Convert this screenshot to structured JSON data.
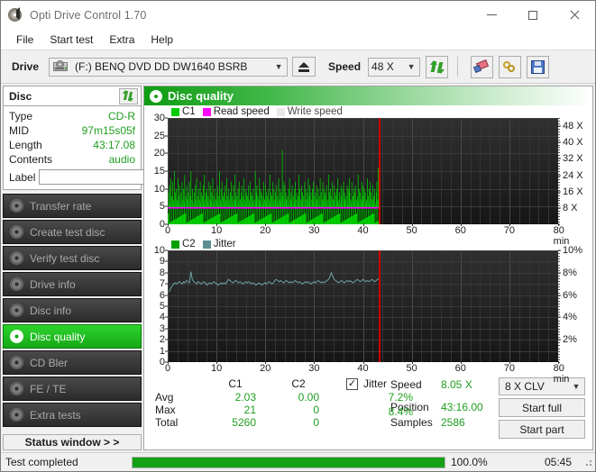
{
  "window": {
    "title": "Opti Drive Control 1.70",
    "icon": "disc-icon",
    "controls": {
      "minimize": "minimize",
      "maximize": "maximize",
      "close": "close"
    }
  },
  "menu": {
    "items": [
      "File",
      "Start test",
      "Extra",
      "Help"
    ]
  },
  "toolbar": {
    "drive_label": "Drive",
    "drive_value": "(F:)   BENQ DVD DD DW1640 BSRB",
    "eject_icon": "eject-icon",
    "speed_label": "Speed",
    "speed_value": "48 X",
    "refresh_icon": "refresh-icon",
    "erase_icon": "eraser-icon",
    "key_icon": "key-icon",
    "save_icon": "save-icon"
  },
  "disc_panel": {
    "title": "Disc",
    "refresh_icon": "refresh-icon",
    "rows": [
      {
        "key": "Type",
        "value": "CD-R"
      },
      {
        "key": "MID",
        "value": "97m15s05f"
      },
      {
        "key": "Length",
        "value": "43:17.08"
      },
      {
        "key": "Contents",
        "value": "audio"
      }
    ],
    "label_key": "Label",
    "label_value": "",
    "label_placeholder": "",
    "cd_icon": "cd-icon"
  },
  "sidebar": {
    "items": [
      {
        "label": "Transfer rate",
        "icon": "disc-icon",
        "active": false
      },
      {
        "label": "Create test disc",
        "icon": "disc-write-icon",
        "active": false
      },
      {
        "label": "Verify test disc",
        "icon": "disc-check-icon",
        "active": false
      },
      {
        "label": "Drive info",
        "icon": "drive-info-icon",
        "active": false
      },
      {
        "label": "Disc info",
        "icon": "disc-info-icon",
        "active": false
      },
      {
        "label": "Disc quality",
        "icon": "disc-quality-icon",
        "active": true
      },
      {
        "label": "CD Bler",
        "icon": "disc-icon",
        "active": false
      },
      {
        "label": "FE / TE",
        "icon": "disc-icon",
        "active": false
      },
      {
        "label": "Extra tests",
        "icon": "disc-icon",
        "active": false
      }
    ],
    "status_window": "Status window > >"
  },
  "main": {
    "header_title": "Disc quality",
    "header_icon": "disc-quality-icon"
  },
  "chart_data": [
    {
      "type": "line",
      "name": "c1-chart",
      "title": "",
      "xlabel": "min",
      "ylabel": "",
      "xlim": [
        0,
        80
      ],
      "ylim": [
        0,
        30
      ],
      "xticks": [
        0,
        10,
        20,
        30,
        40,
        50,
        60,
        70,
        80
      ],
      "yticks": [
        0,
        5,
        10,
        15,
        20,
        25,
        30
      ],
      "x_unit": "min",
      "y2lim": [
        0,
        52
      ],
      "y2ticks": [
        8,
        16,
        24,
        32,
        40,
        48
      ],
      "y2ticklabels": [
        "8 X",
        "16 X",
        "24 X",
        "32 X",
        "40 X",
        "48 X"
      ],
      "grid": true,
      "legend": [
        {
          "label": "C1",
          "color": "#00cc00"
        },
        {
          "label": "Read speed",
          "color": "#ff00ff"
        },
        {
          "label": "Write speed",
          "color": "#e8e8e8"
        }
      ],
      "cursor_position_min": 43.3,
      "data_end_min": 43.3,
      "series": [
        {
          "name": "C1",
          "color": "#00cc00",
          "type": "impulse",
          "x_start": 0,
          "x_end": 43.3,
          "values": [
            5,
            9,
            4,
            11,
            6,
            13,
            5,
            8,
            4,
            12,
            7,
            6,
            15,
            5,
            9,
            4,
            10,
            6,
            7,
            13,
            5,
            8,
            11,
            4,
            6,
            9,
            5,
            12,
            7,
            4,
            10,
            6,
            14,
            5,
            8,
            4,
            11,
            7,
            5,
            9,
            6,
            12,
            4,
            8,
            15,
            5,
            7,
            10,
            4,
            6,
            9,
            5,
            11,
            7,
            4,
            13,
            6,
            8,
            5,
            10,
            4,
            7,
            12,
            6,
            9,
            5,
            8,
            4,
            11,
            6,
            14,
            5,
            7,
            9,
            4,
            10,
            6,
            8,
            5,
            12,
            4,
            7,
            11,
            6,
            9,
            5,
            13,
            4,
            8,
            6,
            10,
            5,
            7,
            4,
            9,
            11,
            6,
            8,
            5,
            15,
            4,
            7,
            10,
            6,
            12,
            5,
            8,
            4,
            9,
            6,
            11,
            7,
            5,
            13,
            4,
            8,
            6,
            10,
            5,
            7,
            9,
            4,
            12,
            6,
            8,
            5,
            11,
            4,
            7,
            14,
            6,
            9,
            5,
            8,
            4,
            10,
            6,
            12,
            5,
            7,
            4,
            9,
            11,
            6,
            8,
            5,
            13,
            4,
            7,
            10,
            6,
            9,
            5,
            8,
            4,
            11,
            6,
            7,
            12,
            5,
            9,
            4,
            8,
            6,
            10,
            5,
            7,
            4,
            15,
            6,
            9,
            11,
            5,
            8,
            4,
            7,
            13,
            6,
            10,
            5,
            9,
            4,
            8,
            6,
            12,
            5,
            7,
            4,
            11,
            9,
            6,
            8,
            5,
            10,
            4,
            7,
            14,
            6,
            9,
            5,
            8,
            4,
            12,
            6,
            10,
            5,
            7,
            9,
            4,
            11,
            6,
            8,
            5,
            13,
            4,
            7,
            10,
            6,
            9,
            5,
            21,
            8,
            4,
            12,
            6,
            11,
            5,
            9,
            7,
            4,
            8,
            6,
            10,
            5,
            13,
            4,
            7,
            9,
            6,
            11,
            5,
            8,
            4,
            10,
            6,
            12,
            7,
            5,
            9,
            4,
            8,
            6,
            14,
            5,
            10,
            4,
            7,
            11,
            6,
            9,
            5,
            8,
            4,
            12,
            6,
            10,
            5,
            7,
            9,
            4,
            13,
            6,
            8,
            11,
            5,
            9,
            4,
            7,
            10,
            6,
            12,
            5,
            8,
            4,
            9,
            6,
            11,
            7,
            5,
            10,
            4,
            8,
            6,
            13,
            5,
            9,
            4,
            7,
            12,
            6,
            10,
            5,
            8,
            9,
            4,
            11,
            6,
            7,
            5,
            14,
            4,
            9,
            6,
            10,
            5,
            8,
            12,
            4,
            7,
            6,
            11,
            5,
            9,
            4,
            8,
            10,
            6,
            13,
            5,
            7,
            9,
            4,
            6,
            11,
            8,
            5,
            10,
            4,
            12,
            6,
            9,
            7,
            5,
            8,
            4,
            11,
            6,
            10,
            5,
            13,
            9,
            4,
            7,
            6,
            12,
            5,
            8,
            4,
            10,
            6,
            9,
            11,
            5,
            7,
            4,
            8,
            14,
            6,
            10,
            5,
            9,
            4,
            7,
            12,
            6,
            8,
            11,
            5,
            10,
            4,
            9,
            6,
            7,
            5,
            13,
            4,
            8,
            10,
            6,
            12,
            5,
            9,
            4,
            7,
            11,
            6,
            8,
            5,
            10,
            4,
            6,
            9,
            12,
            5,
            7,
            16,
            4
          ]
        },
        {
          "name": "Read speed",
          "color": "#ff00ff",
          "type": "line",
          "x_start": 0,
          "x_end": 43.3,
          "value_const_x": 8.05,
          "values_axis2": [
            8.05
          ]
        }
      ]
    },
    {
      "type": "line",
      "name": "c2-jitter-chart",
      "title": "",
      "xlabel": "min",
      "ylabel": "",
      "xlim": [
        0,
        80
      ],
      "ylim": [
        0,
        10
      ],
      "xticks": [
        0,
        10,
        20,
        30,
        40,
        50,
        60,
        70,
        80
      ],
      "yticks": [
        0,
        1,
        2,
        3,
        4,
        5,
        6,
        7,
        8,
        9,
        10
      ],
      "x_unit": "min",
      "y2lim": [
        0,
        10
      ],
      "y2ticks": [
        2,
        4,
        6,
        8,
        10
      ],
      "y2ticklabels": [
        "2%",
        "4%",
        "6%",
        "8%",
        "10%"
      ],
      "grid": true,
      "legend": [
        {
          "label": "C2",
          "color": "#00cc00"
        },
        {
          "label": "Jitter",
          "color": "#5d8f92"
        }
      ],
      "cursor_position_min": 43.3,
      "data_end_min": 43.3,
      "series": [
        {
          "name": "C2",
          "color": "#00cc00",
          "type": "impulse",
          "values": []
        },
        {
          "name": "Jitter",
          "color": "#6fa3a6",
          "type": "line",
          "x_start": 0.3,
          "x_end": 43.3,
          "values": [
            6.3,
            6.6,
            6.8,
            7.0,
            7.1,
            7.0,
            7.1,
            7.2,
            7.1,
            7.0,
            7.2,
            7.1,
            7.3,
            7.2,
            7.1,
            8.1,
            7.4,
            7.2,
            7.1,
            7.0,
            7.2,
            7.1,
            7.0,
            7.1,
            7.2,
            7.1,
            6.9,
            7.0,
            7.1,
            7.0,
            7.1,
            7.2,
            7.1,
            7.0,
            6.9,
            7.0,
            7.1,
            7.0,
            7.1,
            7.0,
            7.2,
            7.4,
            7.3,
            7.2,
            7.1,
            7.2,
            7.3,
            7.2,
            7.1,
            7.2,
            7.1,
            7.0,
            7.1,
            7.2,
            7.1,
            7.2,
            7.1,
            7.0,
            7.1,
            7.0,
            6.9,
            7.0,
            7.1,
            7.0,
            6.9,
            7.0,
            7.1,
            7.0,
            7.1,
            7.2,
            7.1,
            7.0,
            7.1,
            7.3,
            7.4,
            7.3,
            7.2,
            7.3,
            7.2,
            7.1,
            7.2,
            7.3,
            7.2,
            7.1,
            7.2,
            7.1,
            7.2,
            7.3,
            7.2,
            7.1,
            7.2,
            7.1,
            7.0,
            7.1,
            7.2,
            7.1,
            7.2,
            7.1,
            7.0,
            7.1,
            7.2,
            7.1,
            7.2,
            7.3,
            7.2,
            7.1,
            7.2,
            7.1,
            7.2,
            7.3,
            7.4,
            7.6,
            8.0,
            7.7,
            7.4,
            7.3,
            7.2,
            7.1,
            7.2,
            7.3,
            7.2,
            7.1,
            7.2,
            7.3,
            7.2,
            7.3,
            7.2,
            7.1,
            7.2,
            7.3,
            7.4,
            7.3,
            7.2,
            7.3,
            7.4,
            7.3,
            7.2,
            7.3,
            7.2,
            7.3,
            7.4,
            7.3,
            7.2,
            7.3,
            7.4,
            7.5
          ]
        }
      ]
    }
  ],
  "stats": {
    "columns": [
      "C1",
      "C2"
    ],
    "rows": [
      {
        "label": "Avg",
        "c1": "2.03",
        "c2": "0.00",
        "jitter": "7.2%"
      },
      {
        "label": "Max",
        "c1": "21",
        "c2": "0",
        "jitter": "8.4%"
      },
      {
        "label": "Total",
        "c1": "5260",
        "c2": "0",
        "jitter": ""
      }
    ],
    "jitter_label": "Jitter",
    "jitter_checked": true,
    "speed_label": "Speed",
    "speed_value": "8.05 X",
    "position_label": "Position",
    "position_value": "43:16.00",
    "samples_label": "Samples",
    "samples_value": "2586",
    "speed_select": "8 X CLV",
    "start_full": "Start full",
    "start_part": "Start part"
  },
  "statusbar": {
    "text": "Test completed",
    "progress_percent": 100.0,
    "progress_text": "100.0%",
    "elapsed": "05:45"
  },
  "colors": {
    "accent_green": "#16a016",
    "value_green": "#1e9e1e",
    "c1_green": "#00cc00",
    "read_speed_magenta": "#ff00ff",
    "jitter_teal": "#6fa3a6",
    "cursor_red": "#cc0000",
    "plot_bg": "#262626"
  }
}
